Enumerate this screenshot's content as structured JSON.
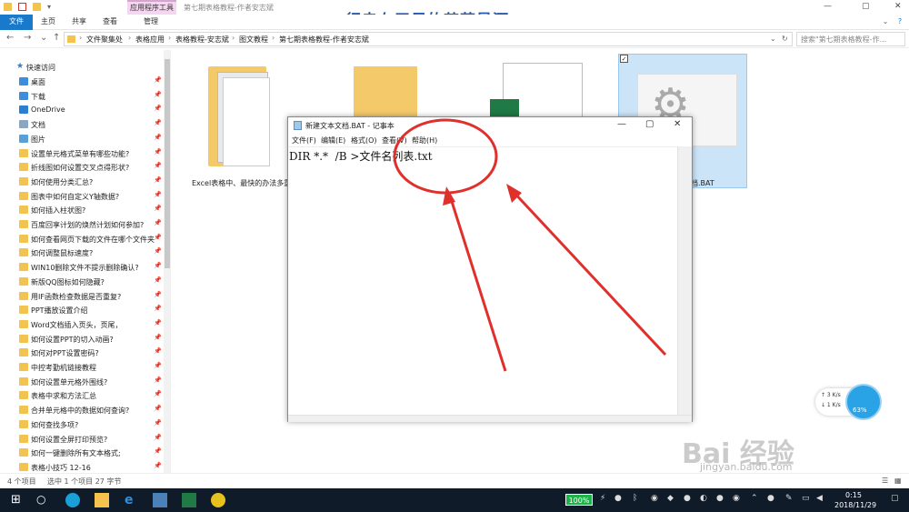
{
  "window": {
    "context_tab_group": "应用程序工具",
    "title": "第七期表格教程-作者安志斌",
    "watermark_title": "行走在无尽的苍茫星河",
    "controls": {
      "minimize": "—",
      "maximize": "▢",
      "close": "✕"
    }
  },
  "ribbon": {
    "tabs": [
      "文件",
      "主页",
      "共享",
      "查看",
      "管理"
    ],
    "active_tab": "文件"
  },
  "address": {
    "breadcrumbs": [
      "文件聚集处",
      "表格应用",
      "表格教程-安志斌",
      "图文教程",
      "第七期表格教程-作者安志斌"
    ],
    "search_placeholder": "搜索\"第七期表格教程-作...",
    "nav": {
      "back": "←",
      "forward": "→",
      "recent": "⌄",
      "up": "↑",
      "refresh": "↻",
      "dropdown": "⌄"
    }
  },
  "sidebar": {
    "quick_access": "快速访问",
    "items": [
      {
        "label": "桌面",
        "icon": "desktop-icon"
      },
      {
        "label": "下载",
        "icon": "download-icon"
      },
      {
        "label": "OneDrive",
        "icon": "cloud-icon"
      },
      {
        "label": "文档",
        "icon": "documents-icon"
      },
      {
        "label": "图片",
        "icon": "pictures-icon"
      },
      {
        "label": "设置单元格式菜单有哪些功能?",
        "icon": "folder-icon"
      },
      {
        "label": "折线图如何设置交叉点得形状?",
        "icon": "folder-icon"
      },
      {
        "label": "如何使用分类汇总?",
        "icon": "folder-icon"
      },
      {
        "label": "图表中如何自定义Y轴数据?",
        "icon": "folder-icon"
      },
      {
        "label": "如何插入柱状图?",
        "icon": "folder-icon"
      },
      {
        "label": "百度回享计划的焕然计划如何参加?",
        "icon": "folder-icon"
      },
      {
        "label": "如何查看网页下载的文件在哪个文件夹",
        "icon": "folder-icon"
      },
      {
        "label": "如何调整鼠标速度?",
        "icon": "folder-icon"
      },
      {
        "label": "WIN10删除文件不提示删除确认?",
        "icon": "folder-icon"
      },
      {
        "label": "新版QQ图标如何隐藏?",
        "icon": "folder-icon"
      },
      {
        "label": "用IF函数检查数据是否重复?",
        "icon": "folder-icon"
      },
      {
        "label": "PPT播放设置介绍",
        "icon": "folder-icon"
      },
      {
        "label": "Word文档插入页头，页尾，",
        "icon": "folder-icon"
      },
      {
        "label": "如何设置PPT的切入动画?",
        "icon": "folder-icon"
      },
      {
        "label": "如何对PPT设置密码?",
        "icon": "folder-icon"
      },
      {
        "label": "中控考勤机链接教程",
        "icon": "folder-icon"
      },
      {
        "label": "如何设置单元格外围线?",
        "icon": "folder-icon"
      },
      {
        "label": "表格中求和方法汇总",
        "icon": "folder-icon"
      },
      {
        "label": "合并单元格中的数据如何查询?",
        "icon": "folder-icon"
      },
      {
        "label": "如何查找多项?",
        "icon": "folder-icon"
      },
      {
        "label": "如何设置全屏打印预览?",
        "icon": "folder-icon"
      },
      {
        "label": "如何一键删除所有文本格式;",
        "icon": "folder-icon"
      },
      {
        "label": "表格小技巧 12-16",
        "icon": "folder-icon"
      }
    ]
  },
  "files": [
    {
      "label": "Excel表格中、最快的办法多重"
    },
    {
      "label": ""
    },
    {
      "label": ""
    },
    {
      "label": "档.BAT",
      "selected": true
    }
  ],
  "notepad": {
    "title": "新建文本文档.BAT - 记事本",
    "menu": [
      "文件(F)",
      "编辑(E)",
      "格式(O)",
      "查看(V)",
      "帮助(H)"
    ],
    "content": "DIR *.*  /B >文件名列表.txt"
  },
  "statusbar": {
    "count": "4 个项目",
    "selection": "选中 1 个项目  27 字节"
  },
  "taskbar": {
    "battery": "100%",
    "time": "0:15",
    "date": "2018/11/29"
  },
  "speed_widget": {
    "up": "↑ 3  K/s",
    "down": "↓ 1  K/s",
    "percent": "63%"
  },
  "watermark": {
    "brand": "Bai 经验",
    "url": "jingyan.baidu.com"
  },
  "colors": {
    "accent": "#1979ca",
    "annotation": "#e0302c",
    "taskbar": "#101b2a"
  }
}
